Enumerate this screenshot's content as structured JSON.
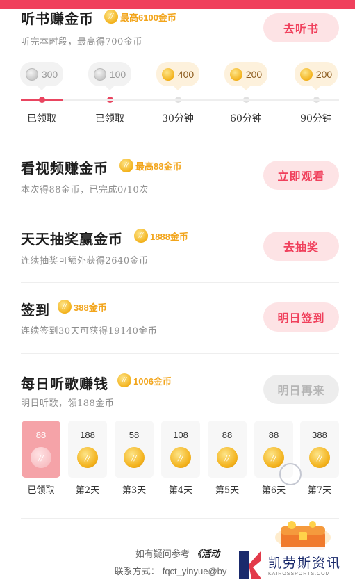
{
  "listen": {
    "title": "听书赚金币",
    "badge": "最高6100金币",
    "subtitle": "听完本时段，最高得700金币",
    "button": "去听书",
    "milestones": [
      {
        "amount": "300",
        "label": "已领取",
        "claimed": true
      },
      {
        "amount": "100",
        "label": "已领取",
        "claimed": true
      },
      {
        "amount": "400",
        "label": "30分钟",
        "claimed": false
      },
      {
        "amount": "200",
        "label": "60分钟",
        "claimed": false
      },
      {
        "amount": "200",
        "label": "90分钟",
        "claimed": false
      }
    ],
    "progress_fraction": 0.13
  },
  "video": {
    "title": "看视频赚金币",
    "badge": "最高88金币",
    "subtitle": "本次得88金币，已完成0/10次",
    "button": "立即观看"
  },
  "lottery": {
    "title": "天天抽奖赢金币",
    "badge": "1888金币",
    "subtitle": "连续抽奖可额外获得2640金币",
    "button": "去抽奖"
  },
  "checkin": {
    "title": "签到",
    "badge": "388金币",
    "subtitle": "连续签到30天可获得19140金币",
    "button": "明日签到"
  },
  "music": {
    "title": "每日听歌赚钱",
    "badge": "1006金币",
    "subtitle": "明日听歌，领188金币",
    "button": "明日再来",
    "days": [
      {
        "amount": "88",
        "label": "已领取",
        "claimed": true
      },
      {
        "amount": "188",
        "label": "第2天",
        "claimed": false
      },
      {
        "amount": "58",
        "label": "第3天",
        "claimed": false
      },
      {
        "amount": "108",
        "label": "第4天",
        "claimed": false
      },
      {
        "amount": "88",
        "label": "第5天",
        "claimed": false
      },
      {
        "amount": "88",
        "label": "第6天",
        "claimed": false
      },
      {
        "amount": "388",
        "label": "第7天",
        "claimed": false
      }
    ]
  },
  "footer": {
    "help_prefix": "如有疑问参考",
    "help_link": "《活动",
    "contact_prefix": "联系方式：",
    "contact_value": "fqct_yinyue@by"
  },
  "watermark": {
    "title": "凯劳斯资讯",
    "subtitle": "KAIROSSPORTS.COM"
  },
  "colors": {
    "accent": "#f0405c",
    "gold": "#f2a51c",
    "button_bg": "#fde3e5",
    "disabled_bg": "#ededed"
  }
}
